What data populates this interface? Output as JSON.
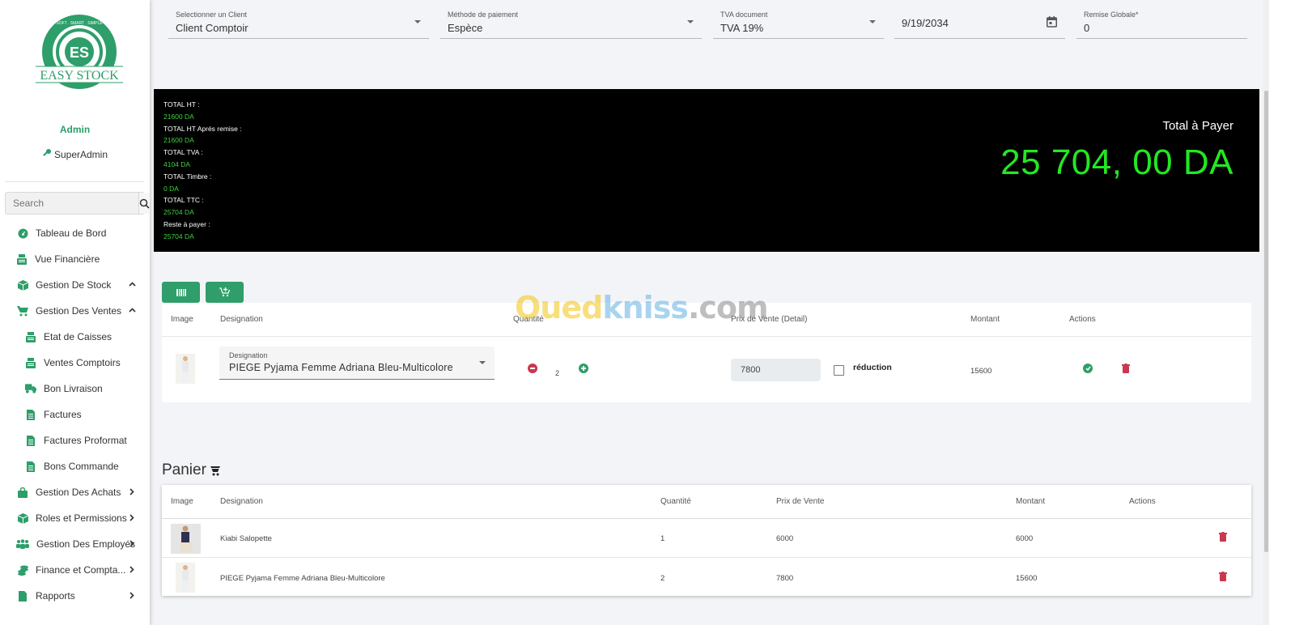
{
  "brand": {
    "name": "EASY STOCK",
    "tagline": "SOFT . SMART . SIMPLE",
    "initials": "ES",
    "color": "#2e9e6a"
  },
  "user": {
    "name": "Admin",
    "role": "SuperAdmin",
    "role_icon": "key-icon"
  },
  "search": {
    "placeholder": "Search",
    "icon": "search-icon"
  },
  "sidebar": {
    "items": [
      {
        "label": "Tableau de Bord",
        "icon": "dashboard-icon",
        "chevron": ""
      },
      {
        "label": "Vue Financière",
        "icon": "cash-register-icon",
        "chevron": ""
      },
      {
        "label": "Gestion De Stock",
        "icon": "box-icon",
        "chevron": "up"
      },
      {
        "label": "Gestion Des Ventes",
        "icon": "cart-icon",
        "chevron": "up"
      },
      {
        "label": "Etat de Caisses",
        "icon": "cash-register-icon",
        "sub": true
      },
      {
        "label": "Ventes Comptoirs",
        "icon": "cash-register-icon",
        "sub": true
      },
      {
        "label": "Bon Livraison",
        "icon": "truck-icon",
        "sub": true
      },
      {
        "label": "Factures",
        "icon": "file-icon",
        "sub": true
      },
      {
        "label": "Factures Proformat",
        "icon": "file-icon",
        "sub": true
      },
      {
        "label": "Bons Commande",
        "icon": "file-icon",
        "sub": true
      },
      {
        "label": "Gestion Des Achats",
        "icon": "bag-icon",
        "chevron": "right"
      },
      {
        "label": "Roles et Permissions",
        "icon": "box-icon",
        "chevron": "right"
      },
      {
        "label": "Gestion Des Employés",
        "icon": "users-icon",
        "chevron": "right"
      },
      {
        "label": "Finance et Compta...",
        "icon": "coins-icon",
        "chevron": "right"
      },
      {
        "label": "Rapports",
        "icon": "file-icon",
        "chevron": "right"
      }
    ]
  },
  "form": {
    "client": {
      "label": "Selectionner un Client",
      "value": "Client Comptoir"
    },
    "payment": {
      "label": "Méthode de paiement",
      "value": "Espèce"
    },
    "tva": {
      "label": "TVA document",
      "value": "TVA 19%"
    },
    "date": {
      "value": "9/19/2034"
    },
    "remise": {
      "label": "Remise Globale*",
      "value": "0"
    }
  },
  "totals": {
    "lines": [
      {
        "label": "TOTAL HT :",
        "value": "21600 DA"
      },
      {
        "label": "TOTAL HT Aprés remise :",
        "value": "21600 DA"
      },
      {
        "label": "TOTAL TVA :",
        "value": "4104 DA"
      },
      {
        "label": "TOTAL Timbre :",
        "value": "0 DA"
      },
      {
        "label": "TOTAL TTC :",
        "value": "25704 DA"
      },
      {
        "label": "Reste à payer :",
        "value": "25704 DA"
      }
    ],
    "big_label": "Total à Payer",
    "big_value": "25 704, 00 DA",
    "accent": "#22e822"
  },
  "toolbar": {
    "barcode_icon": "barcode-icon",
    "add_cart_icon": "add-cart-icon"
  },
  "edit_table": {
    "headers": [
      "Image",
      "Designation",
      "Quantité",
      "Prix de Vente (Detail)",
      "Montant",
      "Actions"
    ],
    "row": {
      "designation_label": "Designation",
      "designation_value": "PIEGE Pyjama Femme Adriana Bleu-Multicolore",
      "quantity": "2",
      "price": "7800",
      "reduction_label": "réduction",
      "reduction_checked": false,
      "amount": "15600"
    }
  },
  "panier": {
    "title": "Panier",
    "headers": [
      "Image",
      "Designation",
      "Quantité",
      "Prix de Vente",
      "Montant",
      "Actions"
    ],
    "rows": [
      {
        "designation": "Kiabi Salopette",
        "quantity": "1",
        "price": "6000",
        "amount": "6000"
      },
      {
        "designation": "PIEGE Pyjama Femme Adriana Bleu-Multicolore",
        "quantity": "2",
        "price": "7800",
        "amount": "15600"
      }
    ]
  },
  "watermark": {
    "part1": "Oued",
    "part2": "kniss",
    "part3": ".com"
  }
}
